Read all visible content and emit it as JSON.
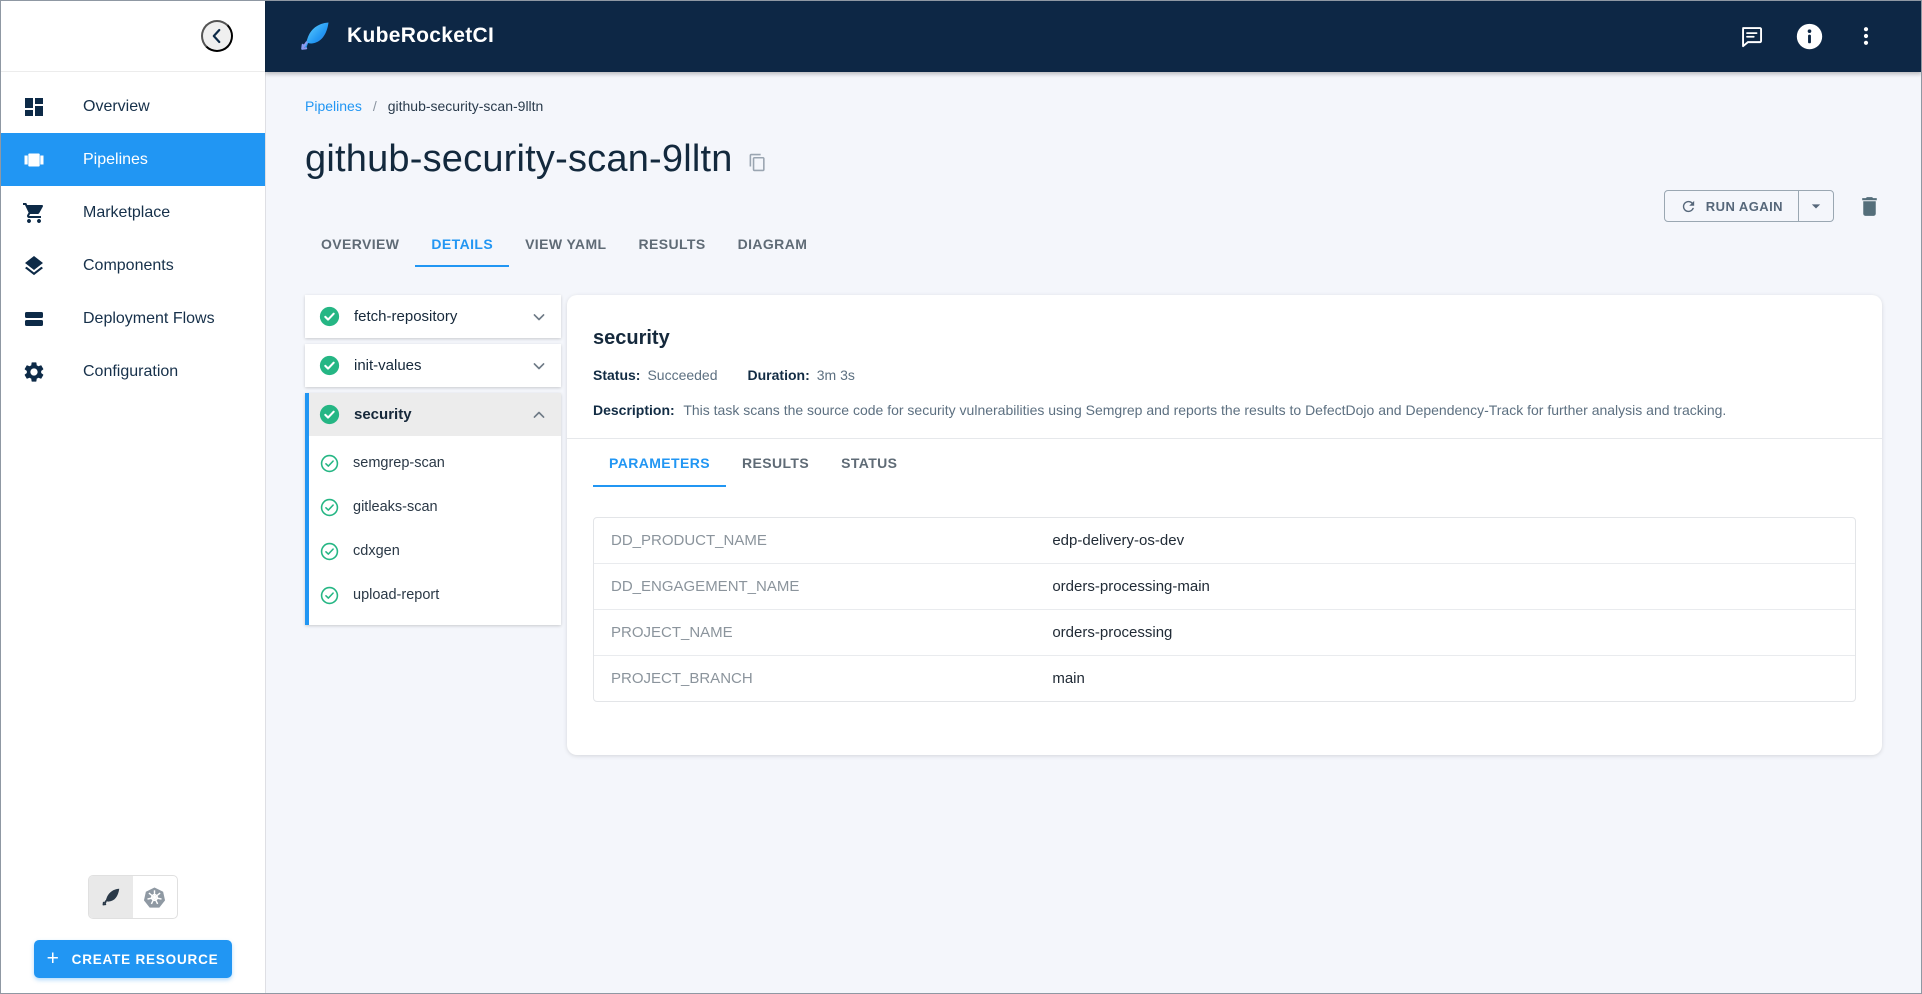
{
  "colors": {
    "header_bg": "#0d2745",
    "accent_blue": "#2196f3",
    "success_green": "#25b684",
    "page_bg": "#f4f6fb",
    "selected_nav_bg": "#2196f3"
  },
  "header": {
    "app_title": "KubeRocketCI",
    "icons": [
      "feather-logo-icon",
      "chat-icon",
      "info-icon",
      "kebab-menu-icon"
    ]
  },
  "sidebar": {
    "collapse_icon": "chevron-left-icon",
    "items": [
      {
        "label": "Overview",
        "icon": "dashboard-icon",
        "active": false
      },
      {
        "label": "Pipelines",
        "icon": "pipelines-icon",
        "active": true
      },
      {
        "label": "Marketplace",
        "icon": "cart-icon",
        "active": false
      },
      {
        "label": "Components",
        "icon": "layers-icon",
        "active": false
      },
      {
        "label": "Deployment Flows",
        "icon": "stack-icon",
        "active": false
      },
      {
        "label": "Configuration",
        "icon": "gear-icon",
        "active": false
      }
    ],
    "footer": {
      "view_toggle_icons": [
        "feather-view-icon",
        "kubernetes-view-icon"
      ],
      "create_button_label": "CREATE RESOURCE"
    }
  },
  "breadcrumb": {
    "link": "Pipelines",
    "separator": "/",
    "current": "github-security-scan-9lltn"
  },
  "page": {
    "title": "github-security-scan-9lltn"
  },
  "toolbar": {
    "run_again_label": "RUN AGAIN",
    "icons": [
      "refresh-icon",
      "caret-down-icon",
      "trash-icon"
    ]
  },
  "tabs": {
    "active": "DETAILS",
    "items": [
      {
        "label": "OVERVIEW"
      },
      {
        "label": "DETAILS"
      },
      {
        "label": "VIEW YAML"
      },
      {
        "label": "RESULTS"
      },
      {
        "label": "DIAGRAM"
      }
    ]
  },
  "tasks": {
    "items": [
      {
        "name": "fetch-repository",
        "status": "Succeeded",
        "expanded": false
      },
      {
        "name": "init-values",
        "status": "Succeeded",
        "expanded": false
      },
      {
        "name": "security",
        "status": "Succeeded",
        "expanded": true,
        "selected": true,
        "steps": [
          {
            "name": "semgrep-scan",
            "status": "Succeeded"
          },
          {
            "name": "gitleaks-scan",
            "status": "Succeeded"
          },
          {
            "name": "cdxgen",
            "status": "Succeeded"
          },
          {
            "name": "upload-report",
            "status": "Succeeded"
          }
        ]
      }
    ]
  },
  "details": {
    "title": "security",
    "status_label": "Status:",
    "status_value": "Succeeded",
    "duration_label": "Duration:",
    "duration_value": "3m 3s",
    "description_label": "Description:",
    "description_value": "This task scans the source code for security vulnerabilities using Semgrep and reports the results to DefectDojo and Dependency-Track for further analysis and tracking.",
    "subtabs": {
      "active": "PARAMETERS",
      "items": [
        {
          "label": "PARAMETERS"
        },
        {
          "label": "RESULTS"
        },
        {
          "label": "STATUS"
        }
      ]
    },
    "parameters": [
      {
        "key": "DD_PRODUCT_NAME",
        "value": "edp-delivery-os-dev"
      },
      {
        "key": "DD_ENGAGEMENT_NAME",
        "value": "orders-processing-main"
      },
      {
        "key": "PROJECT_NAME",
        "value": "orders-processing"
      },
      {
        "key": "PROJECT_BRANCH",
        "value": "main"
      }
    ]
  }
}
